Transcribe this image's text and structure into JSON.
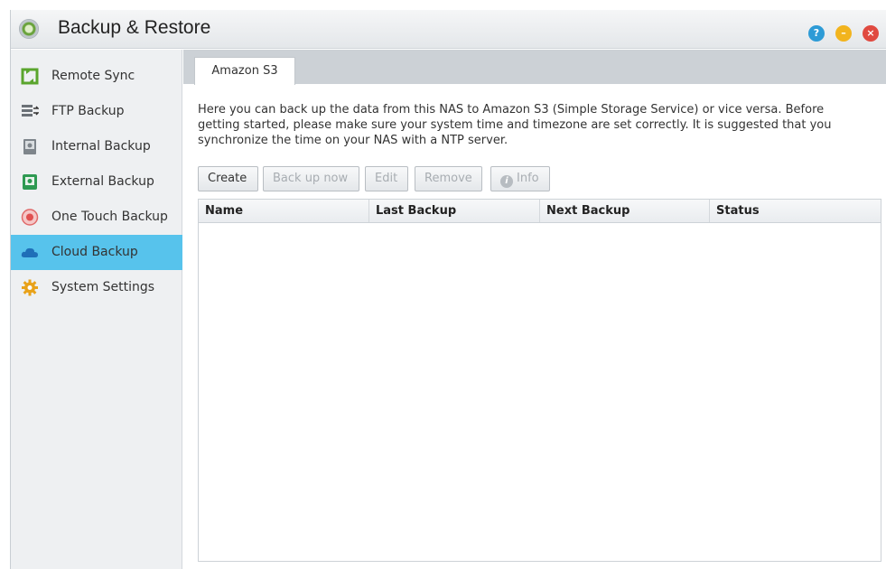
{
  "window": {
    "title": "Backup & Restore",
    "icons": [
      "help-icon",
      "minimize-icon",
      "close-icon"
    ],
    "accent_color": "#57c3ec"
  },
  "sidebar": {
    "items": [
      {
        "label": "Remote Sync",
        "icon": "remote-sync-icon"
      },
      {
        "label": "FTP Backup",
        "icon": "ftp-backup-icon"
      },
      {
        "label": "Internal Backup",
        "icon": "internal-backup-icon"
      },
      {
        "label": "External Backup",
        "icon": "external-backup-icon"
      },
      {
        "label": "One Touch Backup",
        "icon": "one-touch-backup-icon"
      },
      {
        "label": "Cloud Backup",
        "icon": "cloud-icon",
        "active": true
      },
      {
        "label": "System Settings",
        "icon": "gear-icon"
      }
    ]
  },
  "main": {
    "tab_label": "Amazon S3",
    "description": "Here you can back up the data from this NAS to Amazon S3 (Simple Storage Service) or vice versa. Before getting started, please make sure your system time and timezone are set correctly. It is suggested that you synchronize the time on your NAS with a NTP server.",
    "buttons": {
      "create": "Create",
      "backup_now": "Back up now",
      "edit": "Edit",
      "remove": "Remove",
      "info": "Info"
    },
    "table": {
      "columns": [
        "Name",
        "Last Backup",
        "Next Backup",
        "Status"
      ],
      "rows": []
    }
  }
}
